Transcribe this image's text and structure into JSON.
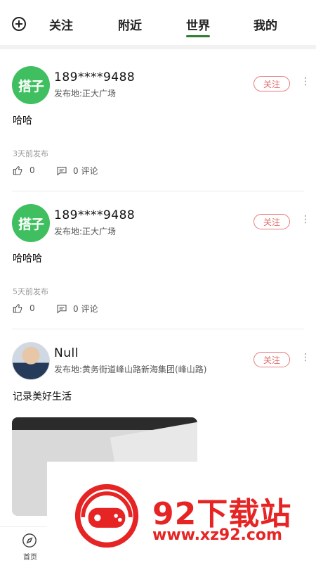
{
  "top_tabs": [
    {
      "label": "关注"
    },
    {
      "label": "附近"
    },
    {
      "label": "世界",
      "active": true
    },
    {
      "label": "我的"
    }
  ],
  "posts": [
    {
      "avatar_text": "搭子",
      "username": "189****9488",
      "location": "发布地:正大广场",
      "follow_label": "关注",
      "content": "哈哈",
      "time": "3天前发布",
      "likes": "0",
      "comments": "0 评论"
    },
    {
      "avatar_text": "搭子",
      "username": "189****9488",
      "location": "发布地:正大广场",
      "follow_label": "关注",
      "content": "哈哈哈",
      "time": "5天前发布",
      "likes": "0",
      "comments": "0 评论"
    },
    {
      "username": "Null",
      "location": "发布地:黄务街道峰山路新海集团(峰山路)",
      "follow_label": "关注",
      "content": "记录美好生活"
    }
  ],
  "bottom_nav": {
    "home_label": "首页"
  },
  "watermark": {
    "title": "92下载站",
    "url": "www.xz92.com"
  },
  "colors": {
    "accent_green": "#3fbf5f",
    "follow_red": "#e26a6a",
    "watermark_red": "#e62424"
  }
}
